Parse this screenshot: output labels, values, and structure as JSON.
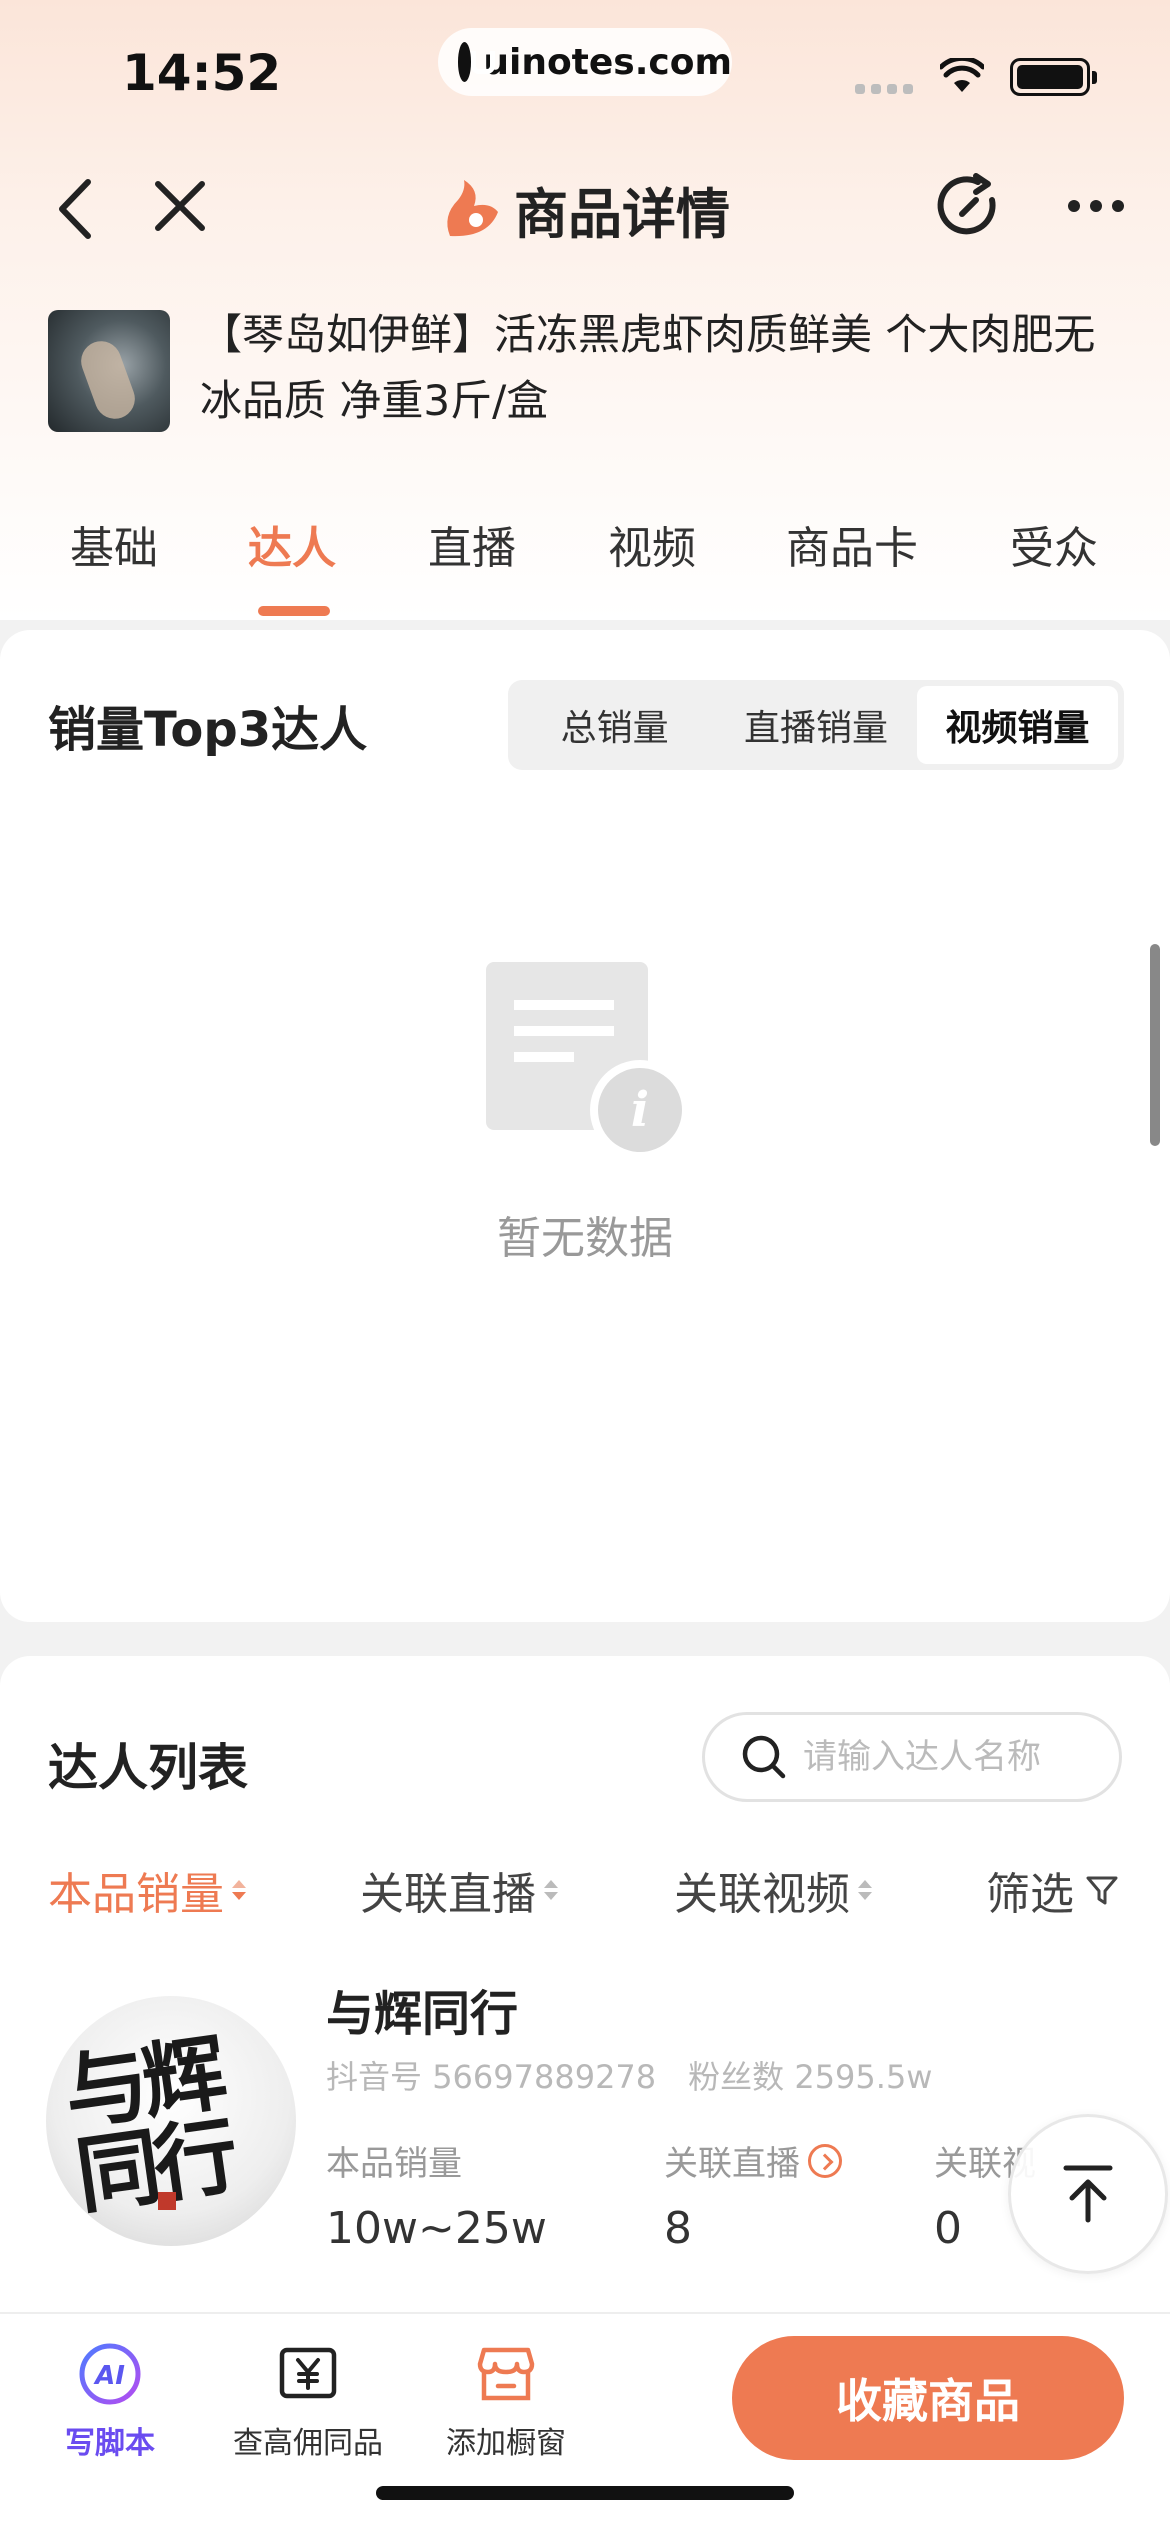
{
  "status_bar": {
    "time": "14:52",
    "url": "uinotes.com"
  },
  "nav": {
    "title": "商品详情"
  },
  "product": {
    "title": "【琴岛如伊鲜】活冻黑虎虾肉质鲜美 个大肉肥无冰品质 净重3斤/盒"
  },
  "tabs": [
    {
      "label": "基础"
    },
    {
      "label": "达人"
    },
    {
      "label": "直播"
    },
    {
      "label": "视频"
    },
    {
      "label": "商品卡"
    },
    {
      "label": "受众"
    }
  ],
  "top3": {
    "title": "销量Top3达人",
    "segments": [
      {
        "label": "总销量"
      },
      {
        "label": "直播销量"
      },
      {
        "label": "视频销量"
      }
    ],
    "active_segment": "视频销量",
    "empty_text": "暂无数据"
  },
  "list": {
    "title": "达人列表",
    "search_placeholder": "请输入达人名称",
    "sort": [
      {
        "label": "本品销量"
      },
      {
        "label": "关联直播"
      },
      {
        "label": "关联视频"
      }
    ],
    "filter_label": "筛选",
    "items": [
      {
        "name": "与辉同行",
        "douyin_label": "抖音号",
        "douyin_id": "56697889278",
        "fans_label": "粉丝数",
        "fans": "2595.5w",
        "avatar_text": "与辉同行",
        "stats": [
          {
            "label": "本品销量",
            "value": "10w~25w"
          },
          {
            "label": "关联直播",
            "value": "8"
          },
          {
            "label": "关联视",
            "value": "0"
          }
        ]
      }
    ]
  },
  "bottom_bar": {
    "items": [
      {
        "label": "写脚本"
      },
      {
        "label": "查高佣同品"
      },
      {
        "label": "添加橱窗"
      }
    ],
    "ai_icon_text": "AI",
    "favorite_label": "收藏商品"
  },
  "colors": {
    "accent": "#ee7a52",
    "ai_purple": "#6a4cf0",
    "background": "#f2f2f2"
  }
}
